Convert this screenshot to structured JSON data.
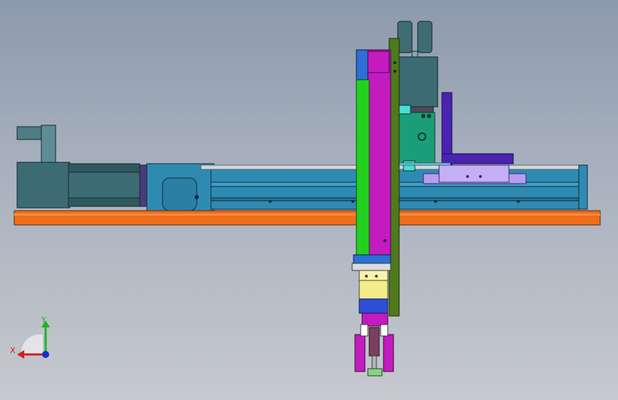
{
  "viewport": {
    "view": "front",
    "background_top": "#8d9aad",
    "background_bottom": "#c6c9ce"
  },
  "triad": {
    "x_label": "X",
    "y_label": "Y",
    "x_color": "#d0201e",
    "y_color": "#1fb41f",
    "z_color": "#1a2fd6"
  },
  "colors": {
    "base_rail": "#f06d1a",
    "linear_axis": "#2f8ab2",
    "motor": "#3c6b74",
    "column_magenta": "#c31bc0",
    "column_green": "#22d11f",
    "plate_olive": "#4f7a1c",
    "carriage_lavender": "#b79cf0",
    "bracket_purple": "#4a23b0",
    "cylinder_teal": "#1a9e7a",
    "gripper_yellow": "#f2ec8c"
  }
}
